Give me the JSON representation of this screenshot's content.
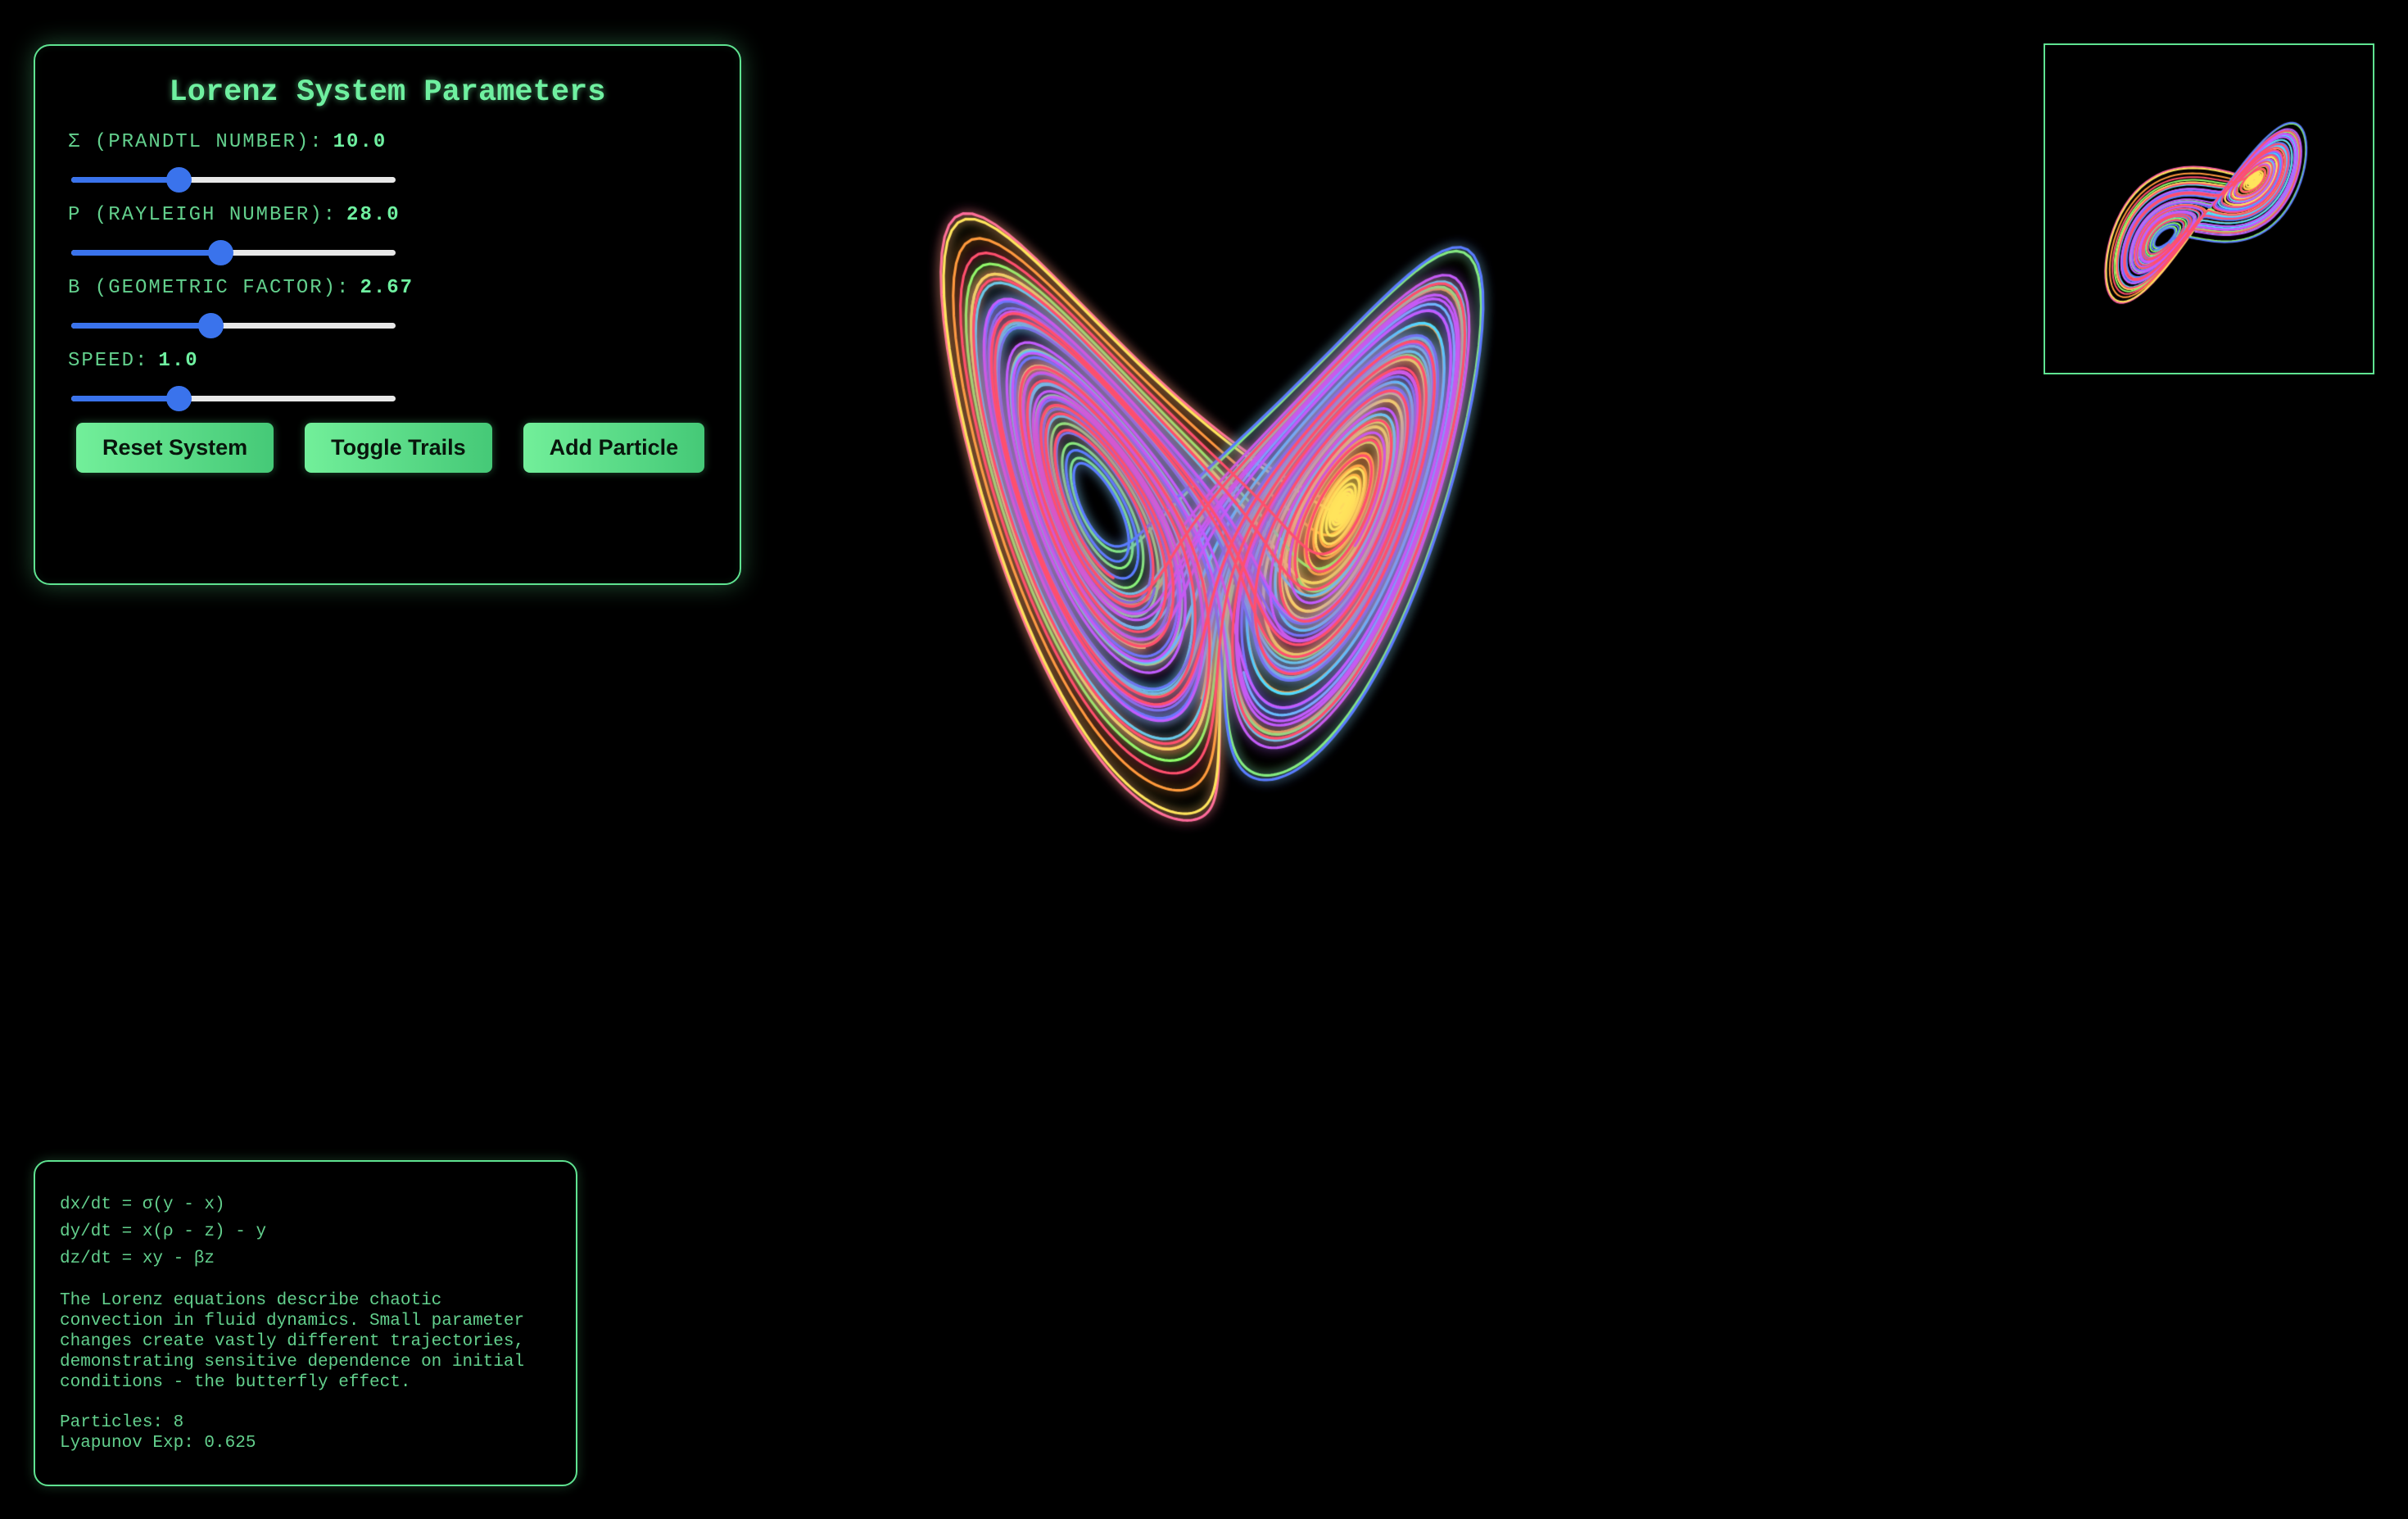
{
  "controls": {
    "title": "Lorenz System Parameters",
    "params": [
      {
        "label": "Σ (PRANDTL NUMBER):",
        "value": "10.0",
        "fraction": 0.33
      },
      {
        "label": "Ρ (RAYLEIGH NUMBER):",
        "value": "28.0",
        "fraction": 0.46
      },
      {
        "label": "Β (GEOMETRIC FACTOR):",
        "value": "2.67",
        "fraction": 0.43
      },
      {
        "label": "SPEED:",
        "value": "1.0",
        "fraction": 0.33
      }
    ],
    "buttons": {
      "reset": "Reset System",
      "toggle_trails": "Toggle Trails",
      "add_particle": "Add Particle"
    }
  },
  "info": {
    "equations": [
      "dx/dt = σ(y - x)",
      "dy/dt = x(ρ - z) - y",
      "dz/dt = xy - βz"
    ],
    "description": "The Lorenz equations describe chaotic convection in fluid dynamics. Small parameter changes create vastly different trajectories, demonstrating sensitive dependence on initial conditions - the butterfly effect.",
    "particles": "Particles: 8",
    "lyapunov": "Lyapunov Exp: 0.625"
  },
  "colors": {
    "accent": "#5fe391",
    "slider": "#3a73ec",
    "trails": [
      "#ff5fa2",
      "#ff9a3c",
      "#ffe45c",
      "#8dff6a",
      "#4fe0ff",
      "#5a7cff",
      "#c25cff",
      "#ff4f6d"
    ]
  }
}
